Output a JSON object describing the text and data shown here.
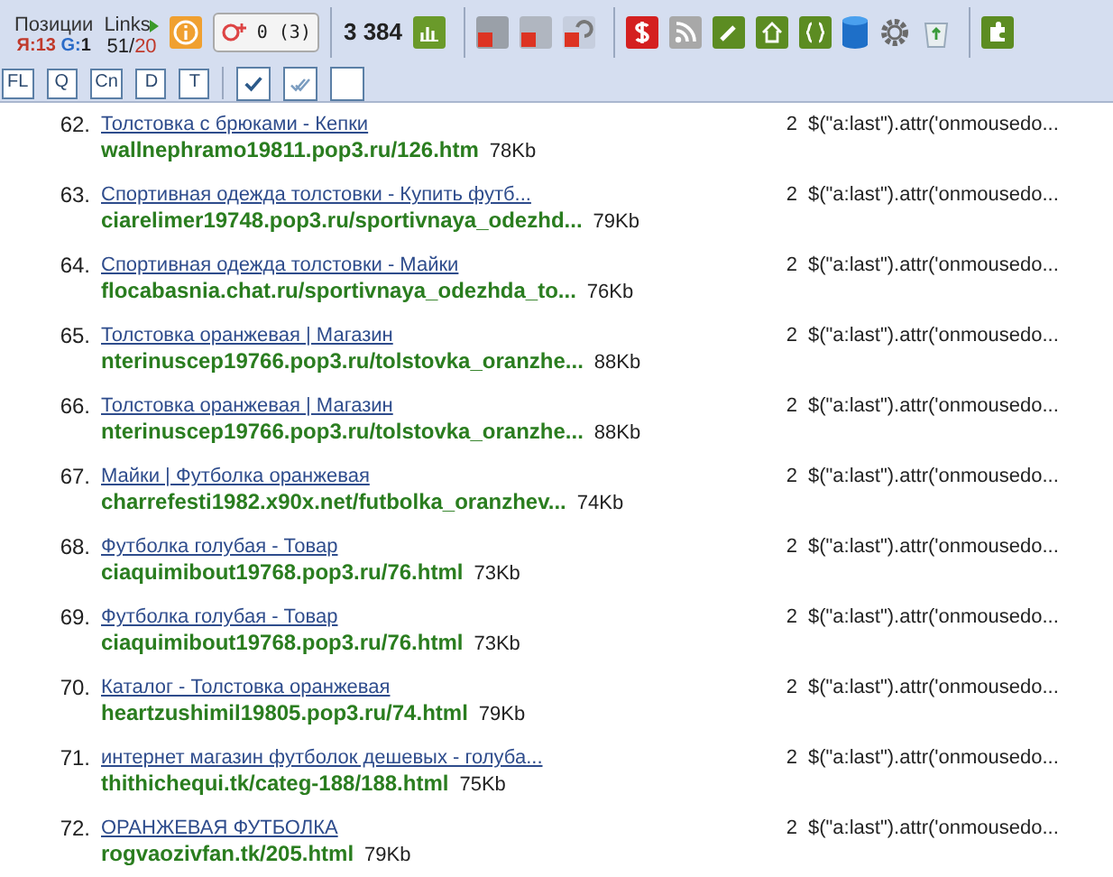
{
  "toolbar": {
    "positions": {
      "label": "Позиции",
      "yandex_label": "Я:",
      "yandex": "13",
      "google_label": "G:",
      "google": "1"
    },
    "links": {
      "label": "Links",
      "indexed": "51",
      "separator": "/",
      "total": "20"
    },
    "gplus": {
      "count": "0 (3)"
    },
    "counter": {
      "value": "3 384"
    },
    "filter_buttons": [
      {
        "label": "FL"
      },
      {
        "label": "Q"
      },
      {
        "label": "Cn"
      },
      {
        "label": "D"
      },
      {
        "label": "T"
      }
    ],
    "check_buttons": [
      {
        "kind": "check"
      },
      {
        "kind": "double-check"
      },
      {
        "kind": "blank"
      }
    ]
  },
  "results": [
    {
      "number": "62.",
      "title": "Толстовка с брюками - Кепки",
      "url": "wallnephramo19811.pop3.ru/126.htm",
      "size": "78Kb",
      "count": "2",
      "code": "$(\"a:last\").attr('onmousedo..."
    },
    {
      "number": "63.",
      "title": "Спортивная одежда толстовки - Купить футб...",
      "url": "ciarelimer19748.pop3.ru/sportivnaya_odezhd...",
      "size": "79Kb",
      "count": "2",
      "code": "$(\"a:last\").attr('onmousedo..."
    },
    {
      "number": "64.",
      "title": "Спортивная одежда толстовки - Майки",
      "url": "flocabasnia.chat.ru/sportivnaya_odezhda_to...",
      "size": "76Kb",
      "count": "2",
      "code": "$(\"a:last\").attr('onmousedo..."
    },
    {
      "number": "65.",
      "title": "Толстовка оранжевая | Магазин",
      "url": "nterinuscep19766.pop3.ru/tolstovka_oranzhe...",
      "size": "88Kb",
      "count": "2",
      "code": "$(\"a:last\").attr('onmousedo..."
    },
    {
      "number": "66.",
      "title": "Толстовка оранжевая | Магазин",
      "url": "nterinuscep19766.pop3.ru/tolstovka_oranzhe...",
      "size": "88Kb",
      "count": "2",
      "code": "$(\"a:last\").attr('onmousedo..."
    },
    {
      "number": "67.",
      "title": "Майки | Футболка оранжевая",
      "url": "charrefesti1982.x90x.net/futbolka_oranzhev...",
      "size": "74Kb",
      "count": "2",
      "code": "$(\"a:last\").attr('onmousedo..."
    },
    {
      "number": "68.",
      "title": "Футболка голубая - Товар",
      "url": "ciaquimibout19768.pop3.ru/76.html",
      "size": "73Kb",
      "count": "2",
      "code": "$(\"a:last\").attr('onmousedo..."
    },
    {
      "number": "69.",
      "title": "Футболка голубая - Товар",
      "url": "ciaquimibout19768.pop3.ru/76.html",
      "size": "73Kb",
      "count": "2",
      "code": "$(\"a:last\").attr('onmousedo..."
    },
    {
      "number": "70.",
      "title": "Каталог - Толстовка оранжевая",
      "url": "heartzushimil19805.pop3.ru/74.html",
      "size": "79Kb",
      "count": "2",
      "code": "$(\"a:last\").attr('onmousedo..."
    },
    {
      "number": "71.",
      "title": "интернет магазин футболок дешевых - голуба...",
      "url": "thithichequi.tk/categ-188/188.html",
      "size": "75Kb",
      "count": "2",
      "code": "$(\"a:last\").attr('onmousedo..."
    },
    {
      "number": "72.",
      "title": "ОРАНЖЕВАЯ ФУТБОЛКА",
      "url": "rogvaozivfan.tk/205.html",
      "size": "79Kb",
      "count": "2",
      "code": "$(\"a:last\").attr('onmousedo..."
    }
  ]
}
